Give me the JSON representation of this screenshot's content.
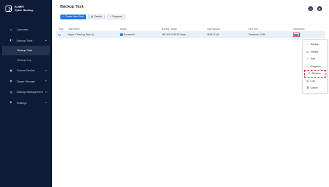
{
  "app": {
    "logo_line1": "AOMEI",
    "logo_line2": "Cyber Backup"
  },
  "sidebar": {
    "items": [
      {
        "label": "Overview",
        "icon": "monitor-icon"
      },
      {
        "label": "Backup Task",
        "icon": "backup-task-icon",
        "expanded": true
      },
      {
        "label": "Source Device",
        "icon": "device-icon"
      },
      {
        "label": "Target Storage",
        "icon": "storage-icon"
      },
      {
        "label": "Backup Management",
        "icon": "management-icon"
      },
      {
        "label": "Settings",
        "icon": "gear-icon"
      }
    ],
    "subitems": [
      {
        "label": "Backup Task",
        "active": true
      },
      {
        "label": "Backup Log",
        "active": false
      }
    ]
  },
  "header": {
    "title": "Backup Task"
  },
  "toolbar": {
    "create_label": "Create New Task",
    "details_label": "Details",
    "progress_label": "Progress"
  },
  "table": {
    "columns": [
      "Type",
      "Task Name",
      "Status",
      "Backup Target",
      "Last Backup",
      "Next Run",
      "Operations"
    ],
    "rows": [
      {
        "type_icon": "hyperv-icon",
        "name": "Hyper-V Backup Task (1)",
        "status": "Successful",
        "target": "\\\\87-20211751127\\shar...",
        "last_backup": "11/08 11:48",
        "next_run": "Tomorrow 11:48",
        "ops": "..."
      }
    ]
  },
  "ops_menu": {
    "items": [
      {
        "label": "Backup",
        "icon": "backup-icon",
        "has_arrow": true
      },
      {
        "label": "Details",
        "icon": "details-icon"
      },
      {
        "label": "Edit",
        "icon": "edit-icon"
      },
      {
        "label": "Progress",
        "icon": "progress-icon"
      },
      {
        "label": "Restore",
        "icon": "restore-icon",
        "highlighted": true
      },
      {
        "label": "Log",
        "icon": "log-icon"
      },
      {
        "label": "Delete",
        "icon": "delete-icon"
      }
    ]
  },
  "colors": {
    "sidebar_bg": "#0d1b36",
    "accent": "#1a73e8",
    "highlight_border": "#d32f2f",
    "selected_row": "#e8f0fb"
  }
}
